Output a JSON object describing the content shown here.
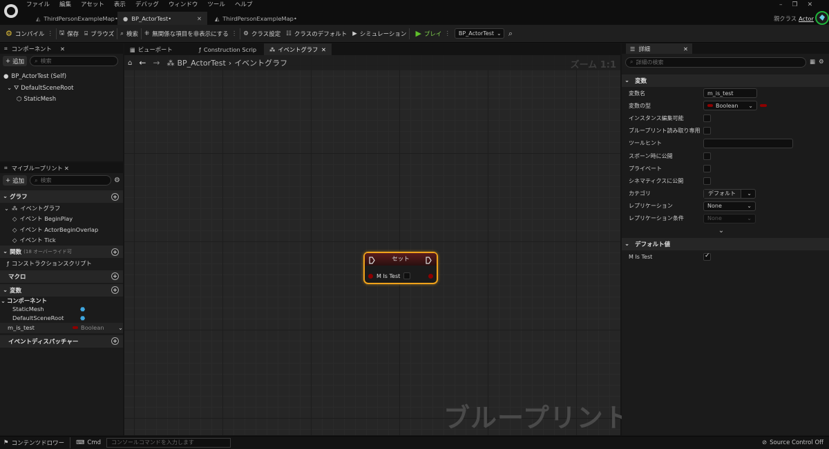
{
  "menu": [
    "ファイル",
    "編集",
    "アセット",
    "表示",
    "デバッグ",
    "ウィンドウ",
    "ツール",
    "ヘルプ"
  ],
  "tabs": [
    {
      "label": "ThirdPersonExampleMap•",
      "active": false
    },
    {
      "label": "BP_ActorTest•",
      "active": true
    },
    {
      "label": "ThirdPersonExampleMap•",
      "active": false
    }
  ],
  "parent_class": {
    "label": "親クラス",
    "value": "Actor"
  },
  "toolbar": {
    "compile": "コンパイル",
    "save": "保存",
    "browse": "ブラウズ",
    "find": "検索",
    "hide_unrelated": "無関係な項目を非表示にする",
    "class_settings": "クラス設定",
    "class_defaults": "クラスのデフォルト",
    "simulation": "シミュレーション",
    "play": "プレイ",
    "debug_object": "BP_ActorTest"
  },
  "components_panel": {
    "title": "コンポーネント",
    "add": "追加",
    "search_placeholder": "検索",
    "self": "BP_ActorTest (Self)",
    "tree": [
      "DefaultSceneRoot",
      "StaticMesh"
    ]
  },
  "mybp_panel": {
    "title": "マイブループリント",
    "add": "追加",
    "search_placeholder": "検索",
    "graph_section": "グラフ",
    "event_graph": "イベントグラフ",
    "events": [
      "イベント BeginPlay",
      "イベント ActorBeginOverlap",
      "イベント Tick"
    ],
    "functions_section": "関数",
    "functions_note": "(18 オーバーライド可",
    "construction_script": "コンストラクションスクリプト",
    "macros_section": "マクロ",
    "variables_section": "変数",
    "components_sub": "コンポーネント",
    "component_vars": [
      "StaticMesh",
      "DefaultSceneRoot"
    ],
    "variable": {
      "name": "m_is_test",
      "type": "Boolean"
    },
    "dispatchers_section": "イベントディスパッチャー"
  },
  "graph": {
    "tabs": [
      "ビューポート",
      "Construction Scrip",
      "イベントグラフ"
    ],
    "breadcrumb_root": "BP_ActorTest",
    "breadcrumb_leaf": "イベントグラフ",
    "zoom": "ズーム 1:1",
    "watermark": "ブループリント",
    "node": {
      "title": "セット",
      "pin": "M Is Test"
    }
  },
  "details": {
    "title": "詳細",
    "search_placeholder": "詳細の検索",
    "section_variable": "変数",
    "rows": {
      "name_label": "変数名",
      "name_value": "m_is_test",
      "type_label": "変数の型",
      "type_value": "Boolean",
      "instance_editable": "インスタンス編集可能",
      "bp_readonly": "ブループリント読み取り専用",
      "tooltip": "ツールヒント",
      "expose_spawn": "スポーン時に公開",
      "private": "プライベート",
      "expose_cinematics": "シネマティクスに公開",
      "category_label": "カテゴリ",
      "category_value": "デフォルト",
      "replication_label": "レプリケーション",
      "replication_value": "None",
      "rep_condition_label": "レプリケーション条件",
      "rep_condition_value": "None"
    },
    "section_default": "デフォルト値",
    "default_label": "M Is Test",
    "default_checked": true
  },
  "status": {
    "content_drawer": "コンテンツドロワー",
    "cmd": "Cmd",
    "console_placeholder": "コンソールコマンドを入力します",
    "source_control": "Source Control Off"
  },
  "colors": {
    "bool_pin": "#8c0000",
    "node_select": "#f0a31b",
    "play": "#5fbf2b",
    "accent_tab": "#3a3a3a"
  }
}
